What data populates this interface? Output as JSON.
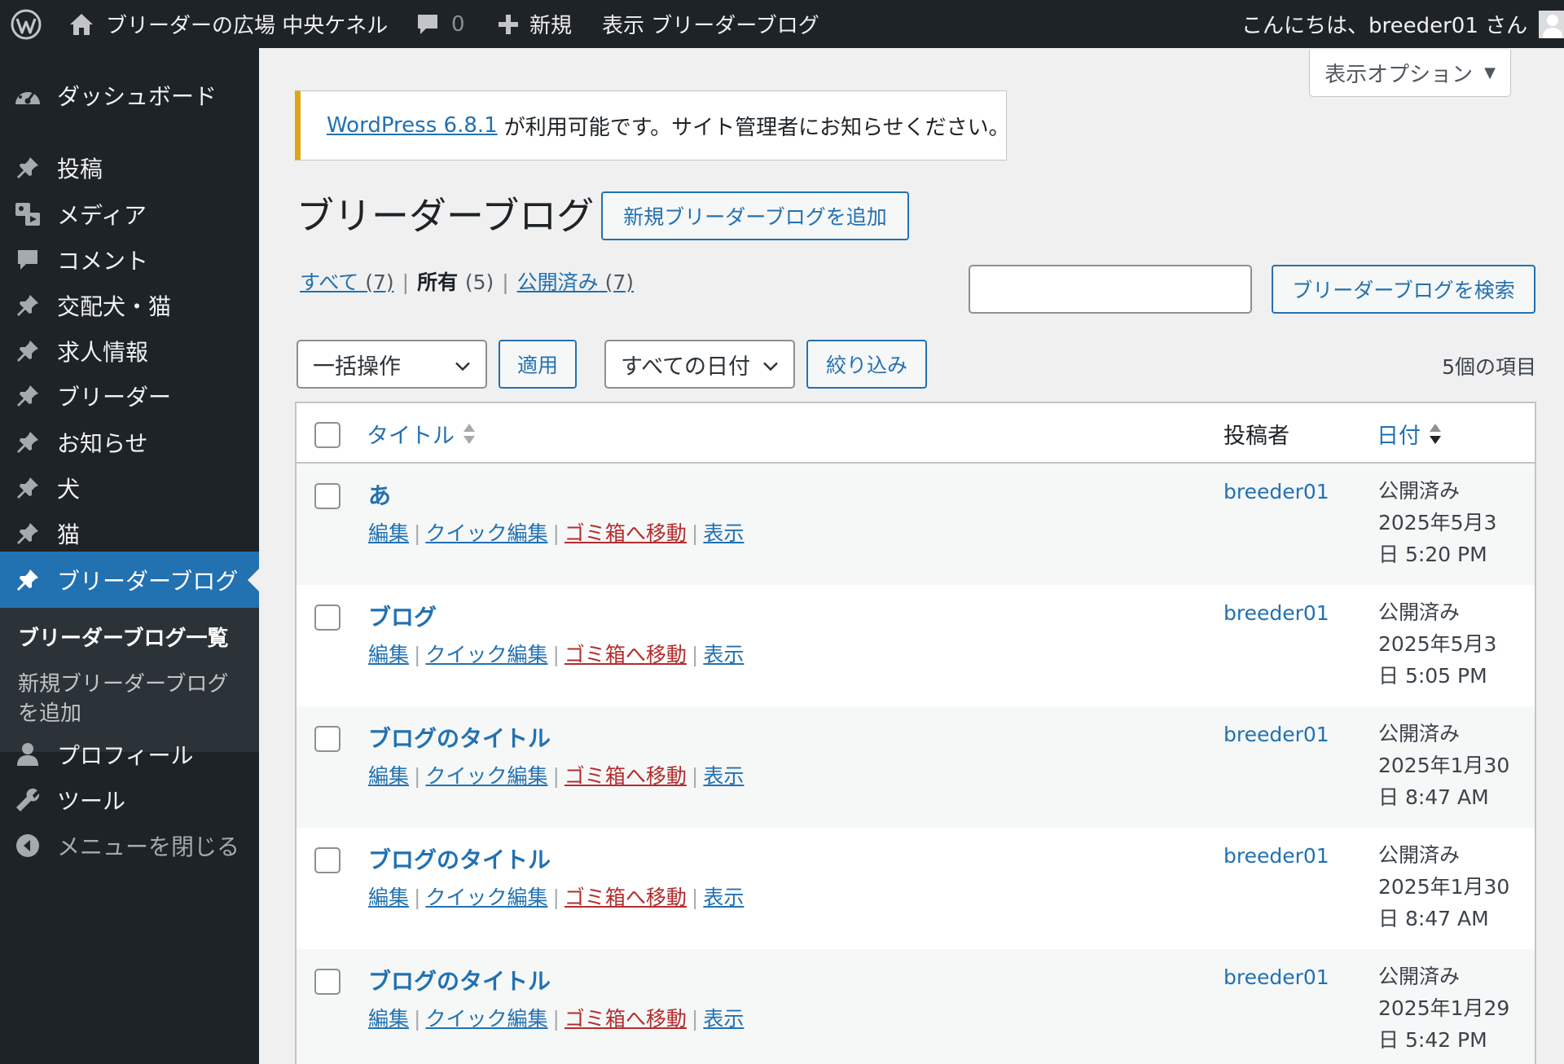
{
  "adminbar": {
    "site_name": "ブリーダーの広場 中央ケネル",
    "comments_count": "0",
    "new_label": "新規",
    "view_label": "表示 ブリーダーブログ",
    "greeting": "こんにちは、breeder01 さん"
  },
  "sidebar": {
    "items": [
      {
        "label": "ダッシュボード",
        "icon": "dashboard-icon"
      },
      {
        "label": "投稿",
        "icon": "pin-icon"
      },
      {
        "label": "メディア",
        "icon": "media-icon"
      },
      {
        "label": "コメント",
        "icon": "comment-icon"
      },
      {
        "label": "交配犬・猫",
        "icon": "pin-icon"
      },
      {
        "label": "求人情報",
        "icon": "pin-icon"
      },
      {
        "label": "ブリーダー",
        "icon": "pin-icon"
      },
      {
        "label": "お知らせ",
        "icon": "pin-icon"
      },
      {
        "label": "犬",
        "icon": "pin-icon"
      },
      {
        "label": "猫",
        "icon": "pin-icon"
      },
      {
        "label": "ブリーダーブログ",
        "icon": "pin-icon"
      }
    ],
    "submenu": {
      "list_label": "ブリーダーブログ一覧",
      "add_label": "新規ブリーダーブログを追加"
    },
    "bottom_items": [
      {
        "label": "プロフィール",
        "icon": "user-icon"
      },
      {
        "label": "ツール",
        "icon": "wrench-icon"
      }
    ],
    "collapse_label": "メニューを閉じる"
  },
  "screen_options": "表示オプション",
  "notice": {
    "link_text": "WordPress 6.8.1",
    "message": "が利用可能です。サイト管理者にお知らせください。"
  },
  "page": {
    "title": "ブリーダーブログ",
    "add_new_button": "新規ブリーダーブログを追加"
  },
  "filters": {
    "all_label": "すべて",
    "all_count": "(7)",
    "mine_label": "所有",
    "mine_count": "(5)",
    "published_label": "公開済み",
    "published_count": "(7)"
  },
  "search": {
    "value": "",
    "button_label": "ブリーダーブログを検索"
  },
  "tablenav": {
    "bulk_action": "一括操作",
    "apply_label": "適用",
    "date_filter": "すべての日付",
    "filter_label": "絞り込み",
    "item_count": "5個の項目"
  },
  "table": {
    "columns": {
      "title": "タイトル",
      "author": "投稿者",
      "date": "日付"
    },
    "row_actions": {
      "edit": "編集",
      "quick_edit": "クイック編集",
      "trash": "ゴミ箱へ移動",
      "view": "表示"
    },
    "rows": [
      {
        "title": "あ",
        "author": "breeder01",
        "status": "公開済み",
        "date_line1": "2025年5月3",
        "date_line2": "日 5:20 PM"
      },
      {
        "title": "ブログ",
        "author": "breeder01",
        "status": "公開済み",
        "date_line1": "2025年5月3",
        "date_line2": "日 5:05 PM"
      },
      {
        "title": "ブログのタイトル",
        "author": "breeder01",
        "status": "公開済み",
        "date_line1": "2025年1月30",
        "date_line2": "日 8:47 AM"
      },
      {
        "title": "ブログのタイトル",
        "author": "breeder01",
        "status": "公開済み",
        "date_line1": "2025年1月30",
        "date_line2": "日 8:47 AM"
      },
      {
        "title": "ブログのタイトル",
        "author": "breeder01",
        "status": "公開済み",
        "date_line1": "2025年1月29",
        "date_line2": "日 5:42 PM"
      }
    ]
  },
  "colors": {
    "adminbar_bg": "#1d2327",
    "accent": "#2271b1",
    "trash": "#b32d2e",
    "notice_border": "#dba617"
  }
}
